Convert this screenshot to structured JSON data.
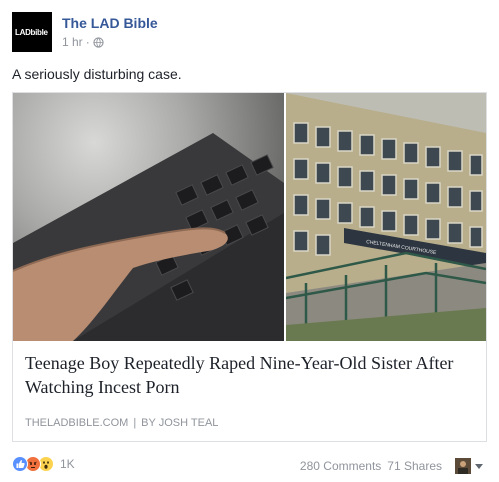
{
  "post": {
    "page_name": "The LAD Bible",
    "avatar_text": "LADbible",
    "timestamp": "1 hr",
    "separator": "·",
    "privacy_icon": "globe-icon",
    "caption": "A seriously disturbing case."
  },
  "link_card": {
    "image_left_alt_icon": "laptop-keyboard-photo",
    "image_right_sign": "CHELTENHAM COURTHOUSE",
    "headline": "Teenage Boy Repeatedly Raped Nine-Year-Old Sister After Watching Incest Porn",
    "domain": "THELADBIBLE.COM",
    "separator": "|",
    "byline": "BY JOSH TEAL"
  },
  "footer": {
    "reaction_icons": [
      "like-icon",
      "angry-icon",
      "wow-icon"
    ],
    "reaction_count": "1K",
    "comments": "280 Comments",
    "shares": "71 Shares"
  },
  "colors": {
    "page_name": "#365899",
    "meta_text": "#90949c",
    "like": "#5890ff",
    "angry": "#f0713d",
    "wow": "#fcd34f"
  }
}
